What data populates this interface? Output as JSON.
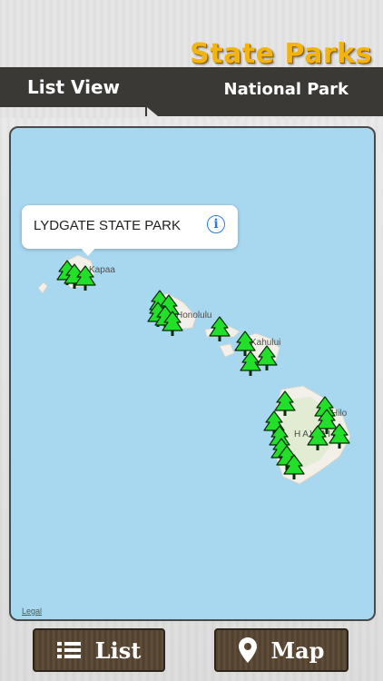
{
  "header": {
    "title": "State Parks",
    "subtitle": "National Park",
    "list_view_label": "List View"
  },
  "map": {
    "callout": {
      "title": "LYDGATE STATE PARK"
    },
    "place_labels": [
      "Kapaa",
      "Honolulu",
      "Kahului",
      "Hilo",
      "HAWAII"
    ],
    "legal_label": "Legal"
  },
  "bottom_bar": {
    "list_label": "List",
    "map_label": "Map"
  },
  "colors": {
    "title": "#f4b410",
    "ocean": "#a8d8f0",
    "tree": "#22e02a",
    "info": "#2a7be0"
  },
  "icons": [
    "list-icon",
    "location-pin-icon",
    "info-icon",
    "tree-marker-icon"
  ]
}
